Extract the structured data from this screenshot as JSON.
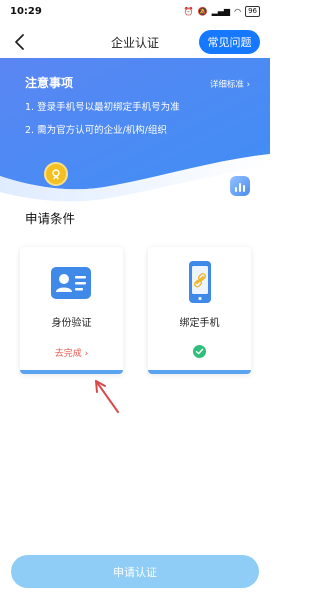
{
  "status_bar": {
    "time": "10:29",
    "battery": "96"
  },
  "nav": {
    "title": "企业认证",
    "faq_label": "常见问题"
  },
  "notice": {
    "title": "注意事项",
    "detail_link": "详细标准",
    "items": [
      "1. 登录手机号以最初绑定手机号为准",
      "2. 需为官方认可的企业/机构/组织"
    ]
  },
  "conditions": {
    "title": "申请条件",
    "cards": [
      {
        "label": "身份验证",
        "action": "去完成",
        "status": "pending",
        "icon": "id-card-icon"
      },
      {
        "label": "绑定手机",
        "status": "done",
        "icon": "phone-link-icon"
      }
    ]
  },
  "submit": {
    "label": "申请认证"
  },
  "colors": {
    "primary": "#1677ff",
    "banner_blue": "#4a8cf0",
    "submit_disabled": "#8fcdf6",
    "todo_red": "#e35a50",
    "done_green": "#2fbf7a"
  }
}
